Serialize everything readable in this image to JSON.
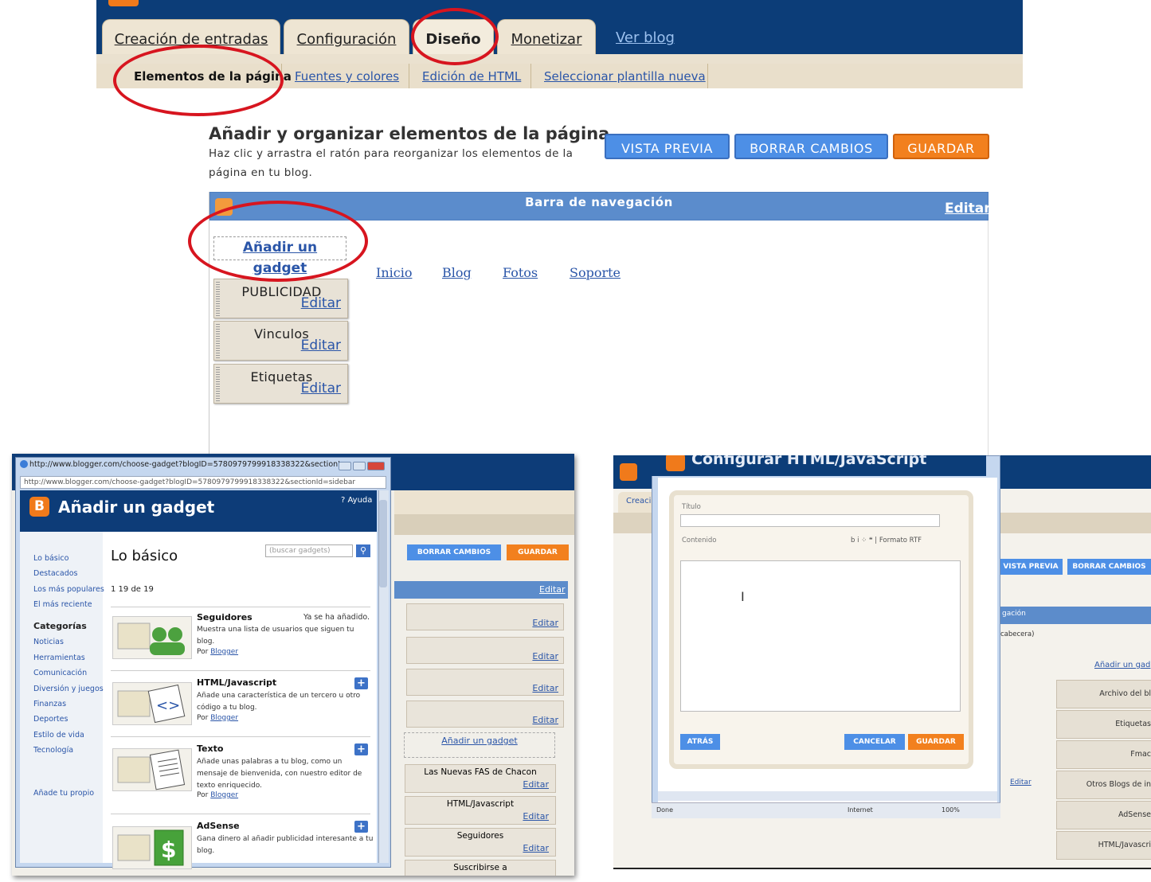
{
  "blogger": {
    "tabs": [
      "Creación de entradas",
      "Configuración",
      "Diseño",
      "Monetizar"
    ],
    "view_blog": "Ver blog",
    "subtabs": [
      "Elementos de la página",
      "Fuentes y colores",
      "Edición de HTML",
      "Seleccionar plantilla nueva"
    ],
    "heading": "Añadir y organizar elementos de la página",
    "description": "Haz clic y arrastra el ratón para reorganizar los elementos de la página en tu blog.",
    "buttons": {
      "preview": "VISTA PREVIA",
      "clear": "BORRAR CAMBIOS",
      "save": "GUARDAR"
    },
    "navbar_title": "Barra de navegación",
    "edit": "Editar",
    "add_gadget": "Añadir un gadget",
    "gadgets": [
      "PUBLICIDAD",
      "Vinculos",
      "Etiquetas"
    ],
    "nav_links": [
      "Inicio",
      "Blog",
      "Fotos",
      "Soporte"
    ],
    "colors": {
      "header": "#0c3d78",
      "accent_orange": "#f2801e",
      "accent_blue": "#4d8fe6",
      "highlight_circle": "#d7151f"
    }
  },
  "gadget_dialog": {
    "window_title": "http://www.blogger.com/choose-gadget?blogID=5780979799918338322&sectionI...",
    "url": "http://www.blogger.com/choose-gadget?blogID=5780979799918338322&sectionId=sidebar",
    "title": "Añadir un gadget",
    "help": "? Ayuda",
    "sidebar": [
      "Lo básico",
      "Destacados",
      "Los más populares",
      "El más reciente"
    ],
    "categories_label": "Categorías",
    "categories": [
      "Noticias",
      "Herramientas",
      "Comunicación",
      "Diversión y juegos",
      "Finanzas",
      "Deportes",
      "Estilo de vida",
      "Tecnología"
    ],
    "add_own": "Añade tu propio",
    "section_title": "Lo básico",
    "search_placeholder": "(buscar gadgets)",
    "count": "1 19 de 19",
    "already_added": "Ya se ha añadido.",
    "by": "Por",
    "by_name": "Blogger",
    "items": [
      {
        "title": "Seguidores",
        "desc": "Muestra una lista de usuarios que siguen tu blog."
      },
      {
        "title": "HTML/Javascript",
        "desc": "Añade una característica de un tercero u otro código a tu blog."
      },
      {
        "title": "Texto",
        "desc": "Añade unas palabras a tu blog, como un mensaje de bienvenida, con nuestro editor de texto enriquecido."
      },
      {
        "title": "AdSense",
        "desc": "Gana dinero al añadir publicidad interesante a tu blog."
      }
    ],
    "background": {
      "clear": "BORRAR CAMBIOS",
      "save": "GUARDAR",
      "edit": "Editar",
      "add_gadget": "Añadir un gadget",
      "gadgets": [
        "Las Nuevas FAS de Chacon",
        "HTML/Javascript",
        "Seguidores",
        "Suscribirse a"
      ]
    }
  },
  "html_dialog": {
    "title": "Configurar HTML/JavaScript",
    "label_title": "Título",
    "label_content": "Contenido",
    "toolbar": "b  i  ⁘  ❝  |  Formato RTF",
    "back": "ATRÁS",
    "cancel": "CANCELAR",
    "save": "GUARDAR",
    "status_left": "Done",
    "status_mid": "Internet",
    "status_zoom": "100%",
    "background": {
      "tab": "Creaci",
      "preview": "VISTA PREVIA",
      "clear": "BORRAR CAMBIOS",
      "nav": "gación",
      "header_note": "cabecera)",
      "add_gadget": "Añadir un gad",
      "edit": "Editar",
      "gadgets": [
        "Archivo del bl",
        "Etiquetas",
        "Fmac",
        "Otros Blogs de in",
        "AdSense",
        "HTML/Javascri"
      ]
    }
  }
}
